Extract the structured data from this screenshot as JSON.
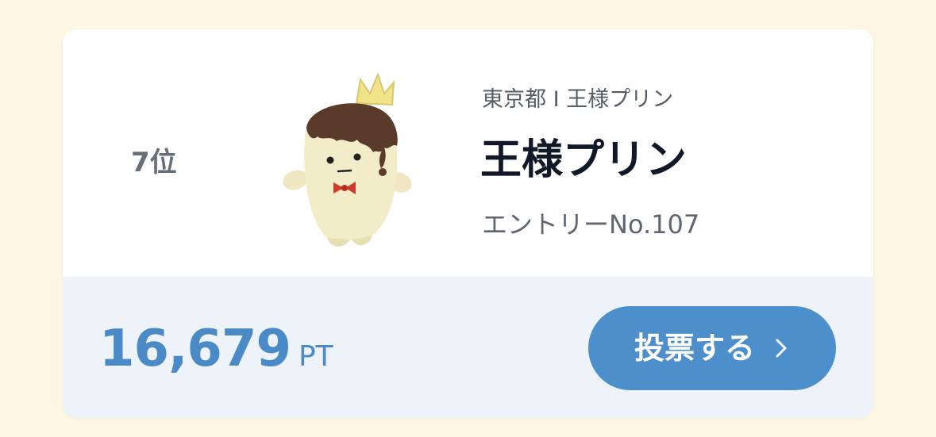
{
  "entry": {
    "rank_label": "7位",
    "meta_line": "東京都 I 王様プリン",
    "name": "王様プリン",
    "entry_number": "エントリーNo.107",
    "mascot": "pudding-king-mascot-image"
  },
  "score": {
    "value": "16,679",
    "unit": "PT"
  },
  "vote_button": {
    "label": "投票する",
    "icon": "chevron-right-icon"
  },
  "colors": {
    "page_background": "#fdf6e3",
    "card_background": "#ffffff",
    "bottom_band": "#edf3f9",
    "accent_blue": "#4c8fcb",
    "points_text": "#4a8bc7"
  }
}
